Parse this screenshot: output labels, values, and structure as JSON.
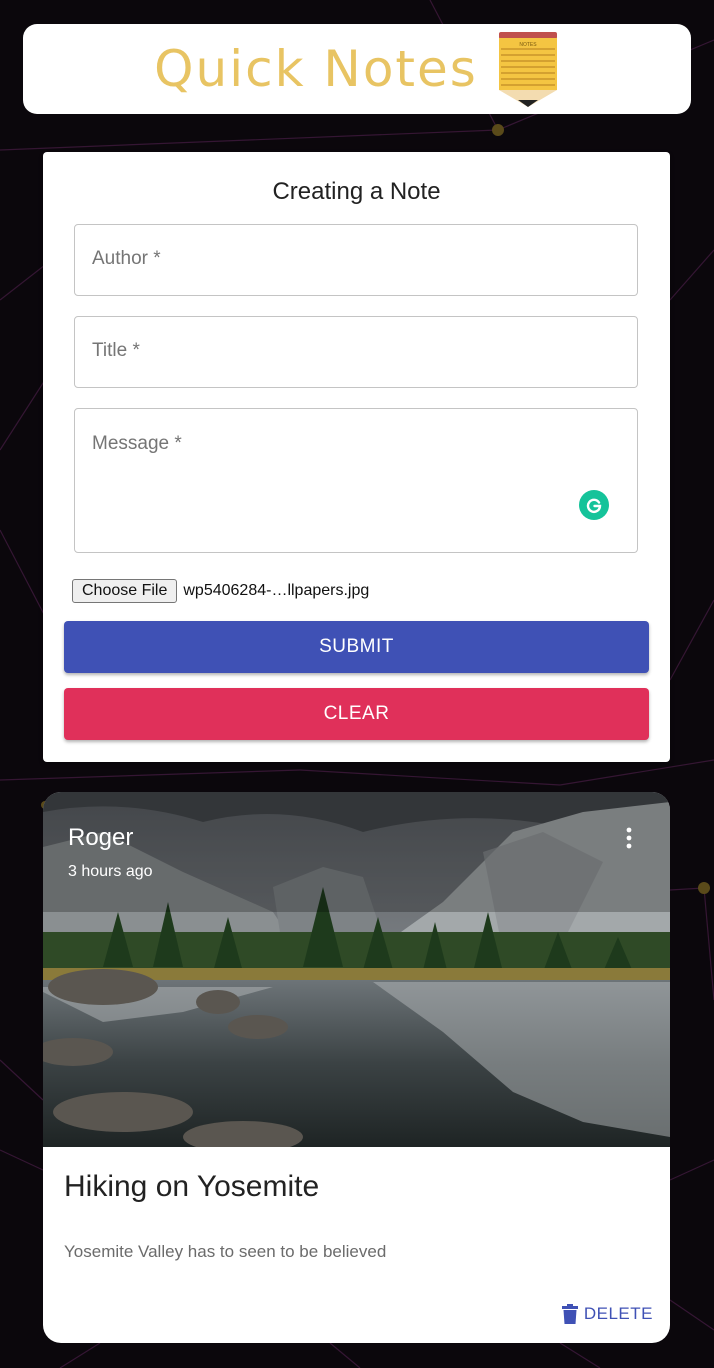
{
  "app": {
    "title": "Quick Notes",
    "logo_icon": "notepad-pencil-icon",
    "logo_text": "NOTES"
  },
  "form": {
    "heading": "Creating a Note",
    "author_label": "Author *",
    "title_label": "Title *",
    "message_label": "Message *",
    "file_button": "Choose File",
    "file_name": "wp5406284-…llpapers.jpg",
    "submit_label": "SUBMIT",
    "clear_label": "CLEAR"
  },
  "note": {
    "author": "Roger",
    "time": "3 hours ago",
    "title": "Hiking on Yosemite",
    "message": "Yosemite Valley has to seen to be believed",
    "delete_label": "DELETE",
    "image_subject": "yosemite-valley-photo"
  },
  "colors": {
    "background": "#0b070c",
    "title_gold": "#e8c463",
    "submit": "#3f51b5",
    "clear": "#e0305a",
    "accent": "#3f51b5",
    "grammarly": "#15c39a"
  }
}
